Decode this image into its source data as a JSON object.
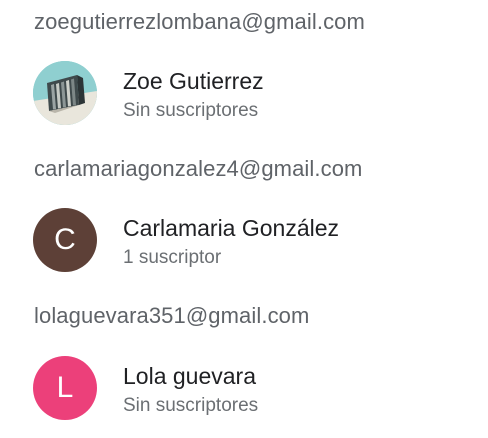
{
  "accounts": [
    {
      "email": "zoegutierrezlombana@gmail.com",
      "channel": {
        "name": "Zoe Gutierrez",
        "subscribers": "Sin suscriptores",
        "avatar_type": "image",
        "avatar_icon": "books-photo-icon",
        "avatar_color": "#8fcfd0"
      }
    },
    {
      "email": "carlamariagonzalez4@gmail.com",
      "channel": {
        "name": "Carlamaria González",
        "subscribers": "1 suscriptor",
        "avatar_type": "letter",
        "avatar_letter": "C",
        "avatar_color": "#5d4037"
      }
    },
    {
      "email": "lolaguevara351@gmail.com",
      "channel": {
        "name": "Lola guevara",
        "subscribers": "Sin suscriptores",
        "avatar_type": "letter",
        "avatar_letter": "L",
        "avatar_color": "#ec407a"
      }
    }
  ]
}
